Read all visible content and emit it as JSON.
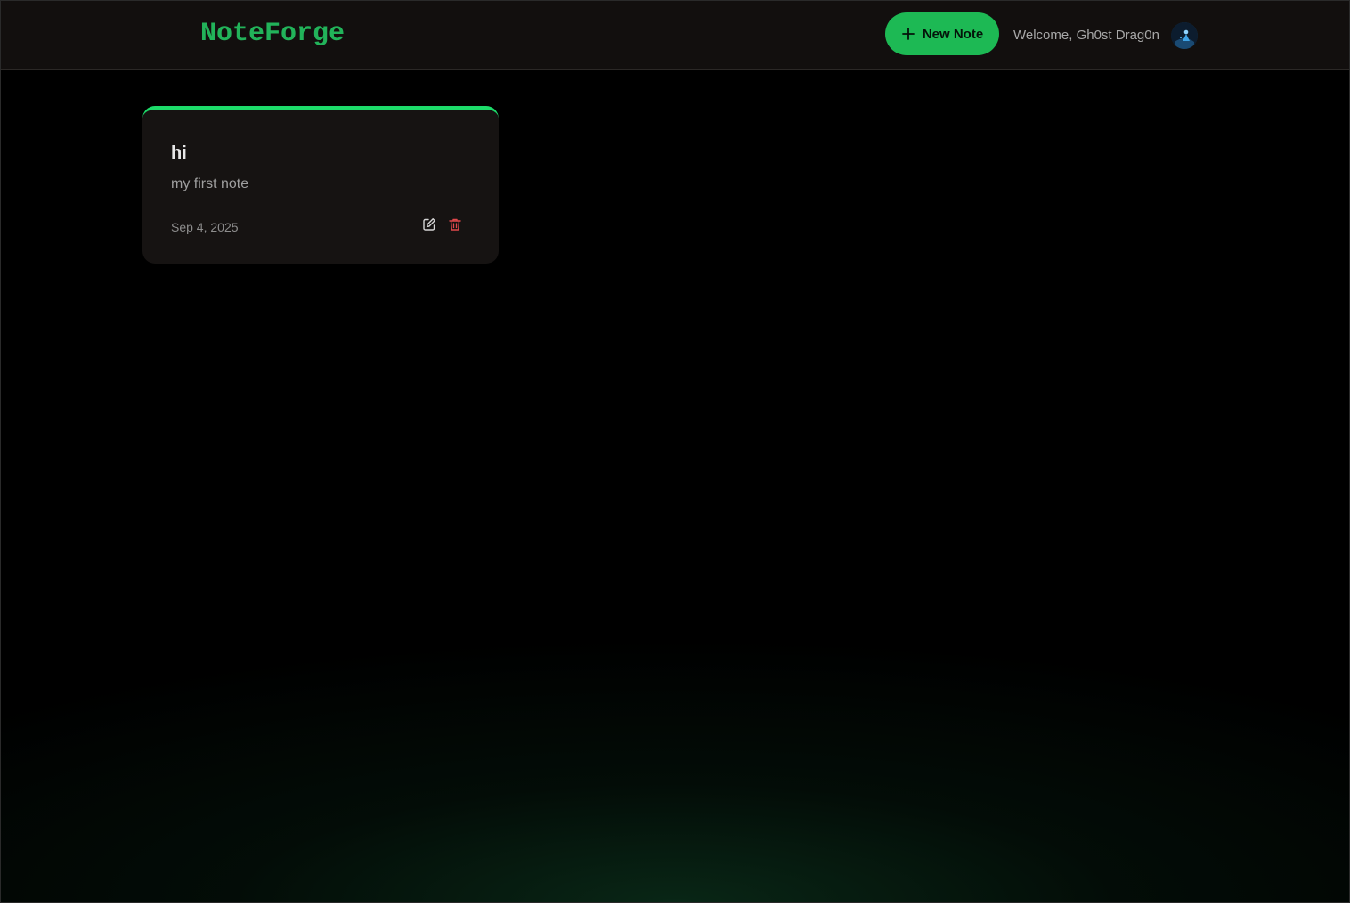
{
  "header": {
    "brand": "NoteForge",
    "new_note_label": "New Note",
    "welcome_text": "Welcome, Gh0st Drag0n",
    "avatar_alt": "avatar"
  },
  "notes": [
    {
      "title": "hi",
      "body": "my first note",
      "date": "Sep 4, 2025"
    }
  ],
  "colors": {
    "accent": "#1db954",
    "brand": "#22b35a",
    "card_top_border": "#1ddc6a",
    "delete": "#e0484b",
    "background": "#000000",
    "header_bg": "#120f0e",
    "card_bg": "#161312"
  },
  "icons": {
    "new_note": "plus-icon",
    "edit": "edit-icon",
    "delete": "trash-icon"
  }
}
